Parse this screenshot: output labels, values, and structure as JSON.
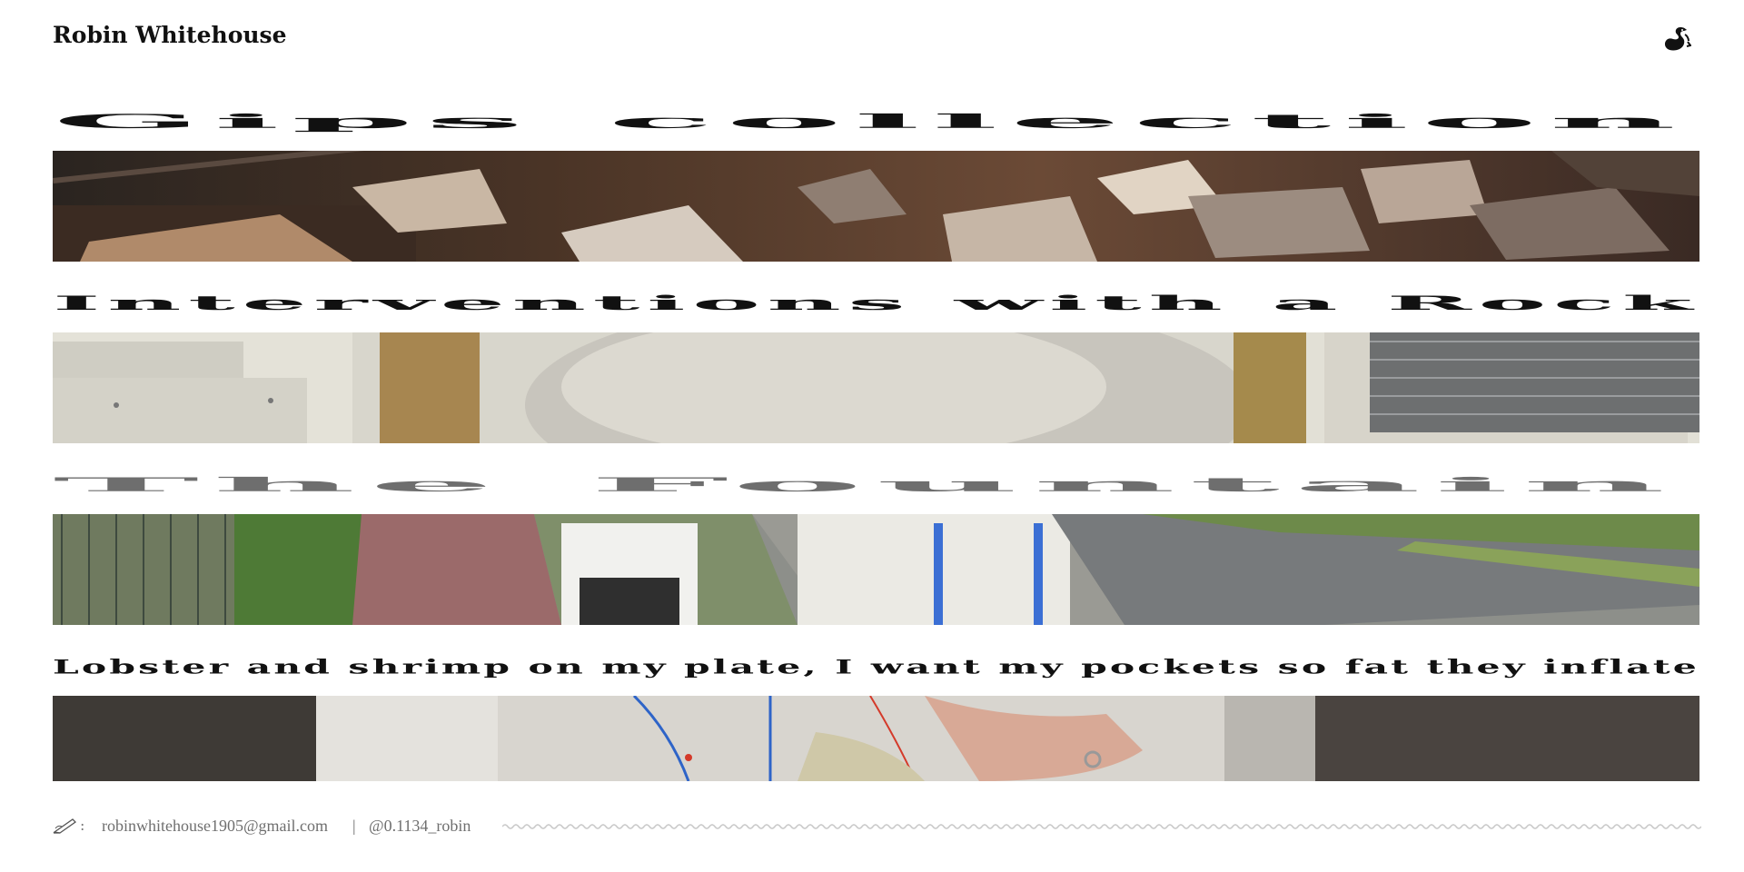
{
  "header": {
    "site_title": "Robin Whitehouse",
    "logo_icon": "swan-icon"
  },
  "projects": [
    {
      "title": "Gips collection",
      "title_color": "#111111",
      "image": "plaster-fragments-photo"
    },
    {
      "title": "Interventions with a Rock",
      "title_color": "#111111",
      "image": "white-rock-in-doorway-photo"
    },
    {
      "title": "The Fountain",
      "title_color": "#6e6e6e",
      "image": "scooter-carrying-fountain-photo"
    },
    {
      "title": "Lobster and shrimp on my plate, I want my pockets so fat they inflate",
      "title_color": "#111111",
      "image": "hand-holding-cast-photo"
    }
  ],
  "footer": {
    "contact_icon": "pen-writing-icon",
    "colon": ":",
    "email": "robinwhitehouse1905@gmail.com",
    "separator": "|",
    "instagram": "@0.1134_robin",
    "decoration": "wavy-line"
  }
}
